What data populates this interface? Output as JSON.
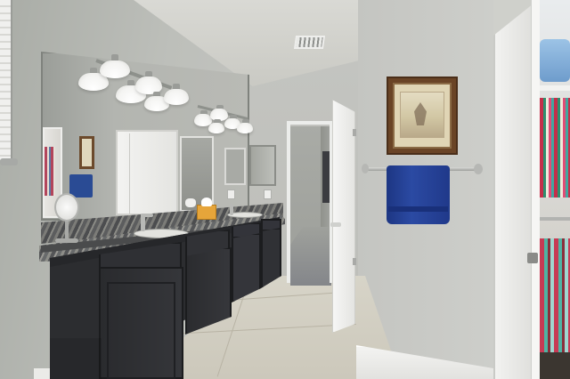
{
  "scene": {
    "colors": {
      "cabinet": "#2c2d30",
      "countertop": "#686a6b",
      "wall": "#c3c4c0",
      "floor_tile": "#d7d4c8",
      "towel": "#2b4aa3",
      "picture_frame": "#6a4426",
      "door": "#f6f6f5",
      "closet_clothes": "#c42f4a"
    }
  }
}
